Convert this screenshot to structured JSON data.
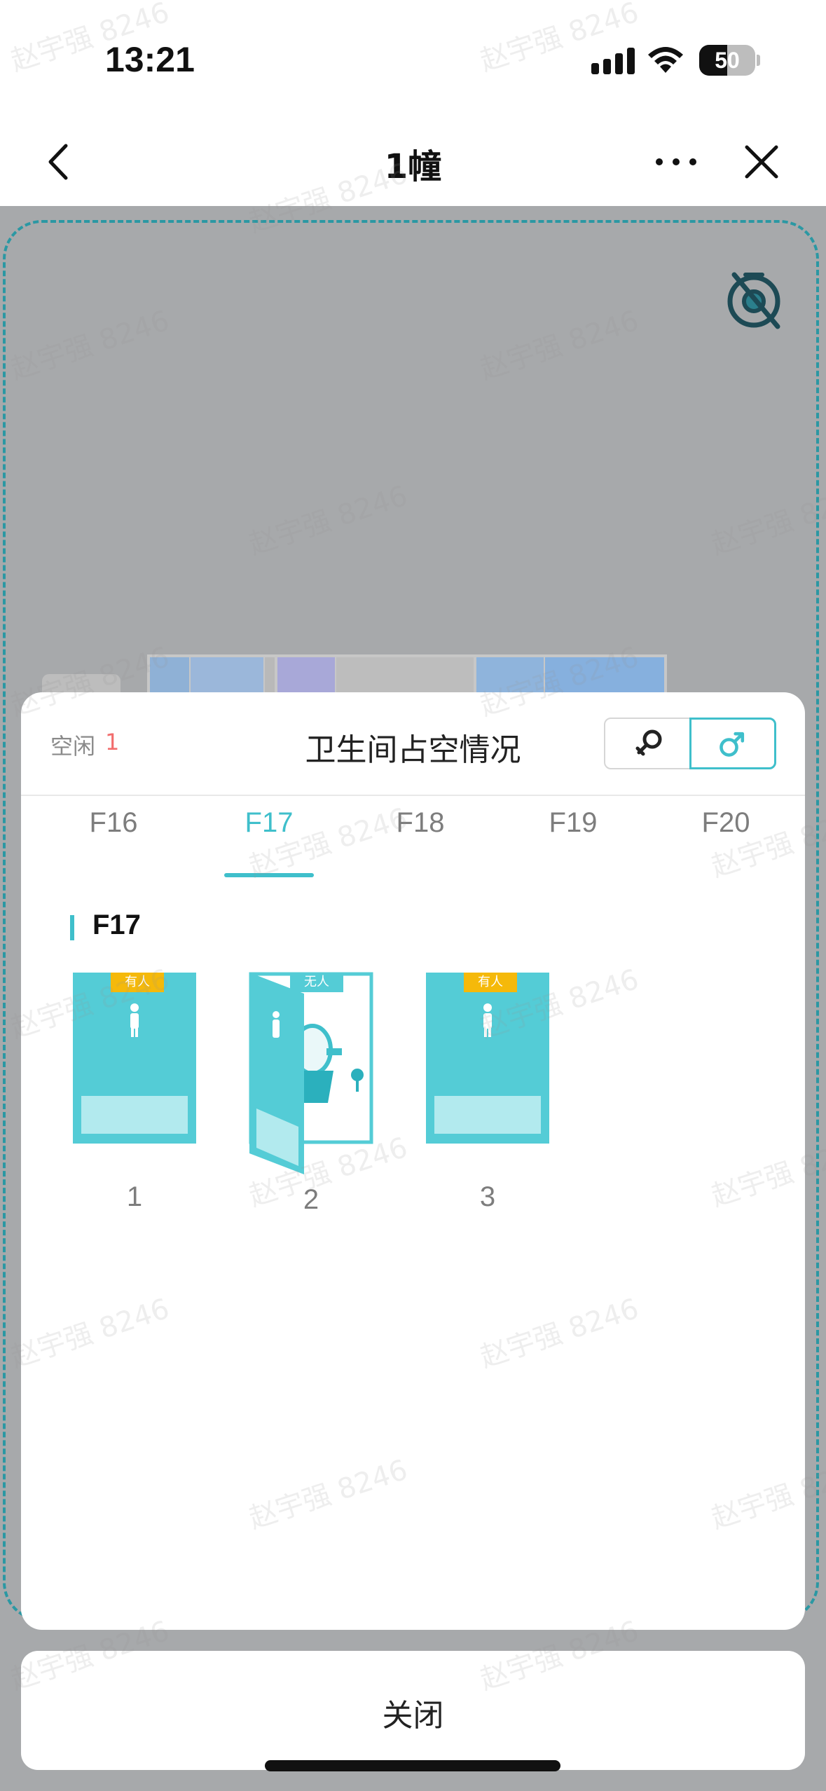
{
  "status_bar": {
    "time": "13:21",
    "battery": "50",
    "battery_level": 0.5
  },
  "nav": {
    "title": "1幢",
    "back_icon": "chevron-left-icon",
    "more_icon": "more-horizontal-icon",
    "close_icon": "close-icon"
  },
  "map": {
    "locate_icon": "locate-off-icon"
  },
  "sheet": {
    "free_label": "空闲",
    "free_count": "1",
    "title": "卫生间占空情况",
    "gender_options": [
      "female",
      "male"
    ],
    "selected_gender": "male",
    "floor_tabs": [
      "F16",
      "F17",
      "F18",
      "F19",
      "F20"
    ],
    "active_floor": "F17",
    "section_title": "F17",
    "stalls": [
      {
        "number": "1",
        "status": "有人",
        "occupied": true
      },
      {
        "number": "2",
        "status": "无人",
        "occupied": false
      },
      {
        "number": "3",
        "status": "有人",
        "occupied": true
      }
    ]
  },
  "close_button": {
    "label": "关闭"
  },
  "watermark": "赵宇强 8246",
  "colors": {
    "accent": "#3fbfcb",
    "stall_fill": "#54ccd6",
    "occupied_badge": "#f5b90a",
    "free_count": "#f26d6d",
    "map_border": "#2b98a3"
  }
}
